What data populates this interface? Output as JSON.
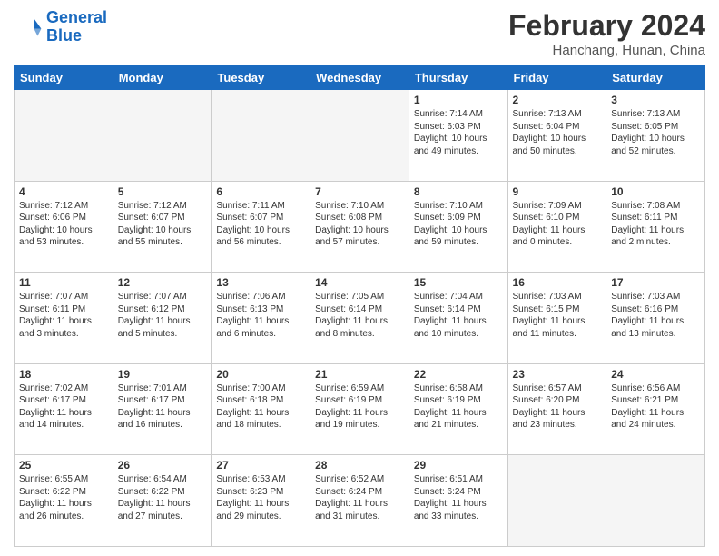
{
  "logo": {
    "line1": "General",
    "line2": "Blue"
  },
  "header": {
    "month": "February 2024",
    "location": "Hanchang, Hunan, China"
  },
  "weekdays": [
    "Sunday",
    "Monday",
    "Tuesday",
    "Wednesday",
    "Thursday",
    "Friday",
    "Saturday"
  ],
  "weeks": [
    [
      {
        "day": "",
        "empty": true
      },
      {
        "day": "",
        "empty": true
      },
      {
        "day": "",
        "empty": true
      },
      {
        "day": "",
        "empty": true
      },
      {
        "day": "1",
        "info": "Sunrise: 7:14 AM\nSunset: 6:03 PM\nDaylight: 10 hours\nand 49 minutes."
      },
      {
        "day": "2",
        "info": "Sunrise: 7:13 AM\nSunset: 6:04 PM\nDaylight: 10 hours\nand 50 minutes."
      },
      {
        "day": "3",
        "info": "Sunrise: 7:13 AM\nSunset: 6:05 PM\nDaylight: 10 hours\nand 52 minutes."
      }
    ],
    [
      {
        "day": "4",
        "info": "Sunrise: 7:12 AM\nSunset: 6:06 PM\nDaylight: 10 hours\nand 53 minutes."
      },
      {
        "day": "5",
        "info": "Sunrise: 7:12 AM\nSunset: 6:07 PM\nDaylight: 10 hours\nand 55 minutes."
      },
      {
        "day": "6",
        "info": "Sunrise: 7:11 AM\nSunset: 6:07 PM\nDaylight: 10 hours\nand 56 minutes."
      },
      {
        "day": "7",
        "info": "Sunrise: 7:10 AM\nSunset: 6:08 PM\nDaylight: 10 hours\nand 57 minutes."
      },
      {
        "day": "8",
        "info": "Sunrise: 7:10 AM\nSunset: 6:09 PM\nDaylight: 10 hours\nand 59 minutes."
      },
      {
        "day": "9",
        "info": "Sunrise: 7:09 AM\nSunset: 6:10 PM\nDaylight: 11 hours\nand 0 minutes."
      },
      {
        "day": "10",
        "info": "Sunrise: 7:08 AM\nSunset: 6:11 PM\nDaylight: 11 hours\nand 2 minutes."
      }
    ],
    [
      {
        "day": "11",
        "info": "Sunrise: 7:07 AM\nSunset: 6:11 PM\nDaylight: 11 hours\nand 3 minutes."
      },
      {
        "day": "12",
        "info": "Sunrise: 7:07 AM\nSunset: 6:12 PM\nDaylight: 11 hours\nand 5 minutes."
      },
      {
        "day": "13",
        "info": "Sunrise: 7:06 AM\nSunset: 6:13 PM\nDaylight: 11 hours\nand 6 minutes."
      },
      {
        "day": "14",
        "info": "Sunrise: 7:05 AM\nSunset: 6:14 PM\nDaylight: 11 hours\nand 8 minutes."
      },
      {
        "day": "15",
        "info": "Sunrise: 7:04 AM\nSunset: 6:14 PM\nDaylight: 11 hours\nand 10 minutes."
      },
      {
        "day": "16",
        "info": "Sunrise: 7:03 AM\nSunset: 6:15 PM\nDaylight: 11 hours\nand 11 minutes."
      },
      {
        "day": "17",
        "info": "Sunrise: 7:03 AM\nSunset: 6:16 PM\nDaylight: 11 hours\nand 13 minutes."
      }
    ],
    [
      {
        "day": "18",
        "info": "Sunrise: 7:02 AM\nSunset: 6:17 PM\nDaylight: 11 hours\nand 14 minutes."
      },
      {
        "day": "19",
        "info": "Sunrise: 7:01 AM\nSunset: 6:17 PM\nDaylight: 11 hours\nand 16 minutes."
      },
      {
        "day": "20",
        "info": "Sunrise: 7:00 AM\nSunset: 6:18 PM\nDaylight: 11 hours\nand 18 minutes."
      },
      {
        "day": "21",
        "info": "Sunrise: 6:59 AM\nSunset: 6:19 PM\nDaylight: 11 hours\nand 19 minutes."
      },
      {
        "day": "22",
        "info": "Sunrise: 6:58 AM\nSunset: 6:19 PM\nDaylight: 11 hours\nand 21 minutes."
      },
      {
        "day": "23",
        "info": "Sunrise: 6:57 AM\nSunset: 6:20 PM\nDaylight: 11 hours\nand 23 minutes."
      },
      {
        "day": "24",
        "info": "Sunrise: 6:56 AM\nSunset: 6:21 PM\nDaylight: 11 hours\nand 24 minutes."
      }
    ],
    [
      {
        "day": "25",
        "info": "Sunrise: 6:55 AM\nSunset: 6:22 PM\nDaylight: 11 hours\nand 26 minutes."
      },
      {
        "day": "26",
        "info": "Sunrise: 6:54 AM\nSunset: 6:22 PM\nDaylight: 11 hours\nand 27 minutes."
      },
      {
        "day": "27",
        "info": "Sunrise: 6:53 AM\nSunset: 6:23 PM\nDaylight: 11 hours\nand 29 minutes."
      },
      {
        "day": "28",
        "info": "Sunrise: 6:52 AM\nSunset: 6:24 PM\nDaylight: 11 hours\nand 31 minutes."
      },
      {
        "day": "29",
        "info": "Sunrise: 6:51 AM\nSunset: 6:24 PM\nDaylight: 11 hours\nand 33 minutes."
      },
      {
        "day": "",
        "empty": true
      },
      {
        "day": "",
        "empty": true
      }
    ]
  ]
}
